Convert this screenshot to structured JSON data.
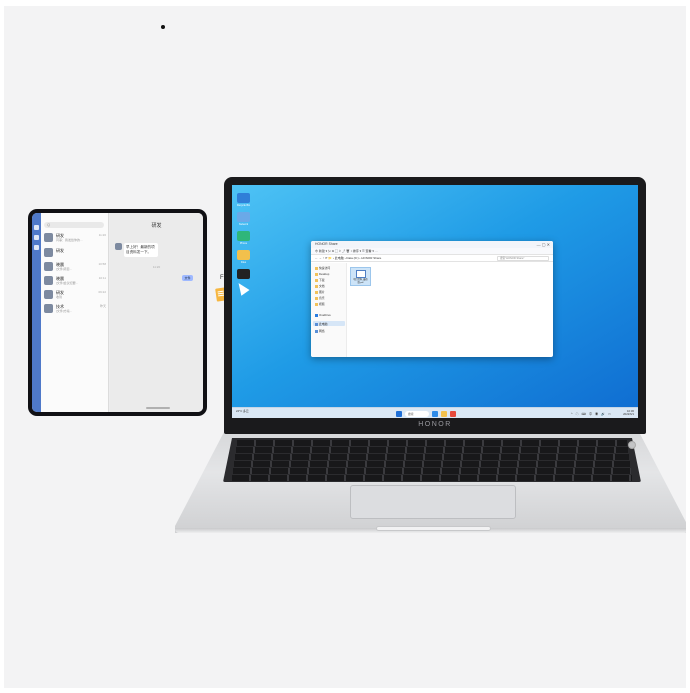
{
  "phone": {
    "search_placeholder": "Q",
    "chat_title": "研发",
    "contacts": [
      {
        "name": "研发",
        "message": "同事：我发给你的…",
        "time": "11:20"
      },
      {
        "name": "研发",
        "message": "",
        "time": ""
      },
      {
        "name": "晓晨",
        "message": "[文件]项目...",
        "time": "10:58"
      },
      {
        "name": "晓晨",
        "message": "[文件]会议纪要...",
        "time": "10:11"
      },
      {
        "name": "研发",
        "message": "收到",
        "time": "09:22"
      },
      {
        "name": "技术",
        "message": "[文件]方案...",
        "time": "昨天"
      }
    ],
    "incoming_message": "早上好！最新的项目资料发一下。",
    "incoming_time": "11:20",
    "outgoing_label": "文件",
    "drag_tag": "Fil"
  },
  "laptop": {
    "brand": "HONOR",
    "desktop_icons": [
      {
        "label": "Recycle Bin",
        "color": "#2f7fd8"
      },
      {
        "label": "Network",
        "color": "#6aa9e8"
      },
      {
        "label": "Phone",
        "color": "#2fb67a"
      },
      {
        "label": "Files",
        "color": "#f2c04c"
      },
      {
        "label": "Gallery",
        "color": "#222222"
      }
    ],
    "explorer": {
      "title": "HONOR Share",
      "toolbar": "⊕ 新建 ▾    ✂  ⧉  ▢  ⇪  ⤴  🗑   ↕ 排序 ▾   ☰ 查看 ▾   ···",
      "address": "← → ↑ ⟳  📁 › 此电脑 › Data (D:) › HONOR Share",
      "search_placeholder": "搜索\"HONOR Share\"",
      "sidebar": [
        "快速访问",
        "Desktop",
        "下载",
        "文档",
        "图片",
        "音乐",
        "视频",
        "OneDrive",
        "此电脑",
        "网络"
      ],
      "file_name": "项目资料_最终版.pdf",
      "item_count": "1 个项目"
    },
    "taskbar": {
      "weather": "24°C 多云",
      "search_label": "搜索",
      "time": "10:30",
      "date": "2022/6/1",
      "tray": "^ ☁ ⌨ 中 ◉ 🔊 ▭"
    },
    "keyboard_rows": 6
  }
}
